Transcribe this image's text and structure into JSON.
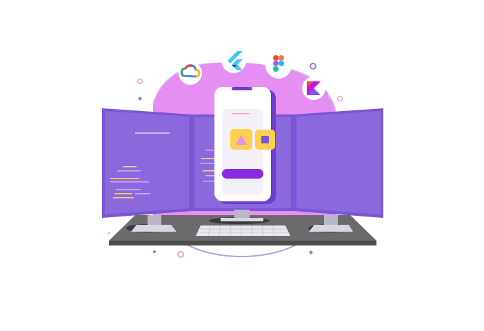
{
  "illustration": {
    "icons": [
      "google-cloud-icon",
      "flutter-icon",
      "figma-icon",
      "kotlin-icon"
    ],
    "colors": {
      "background": "#ffffff",
      "blob": "#e68ff3",
      "orbit": "#b89be8",
      "monitor_frame": "#7a55d6",
      "monitor_screen": "#8c68dd",
      "code_line": "#c9b6f5",
      "code_line_accent": "#ffd36b",
      "desk_top": "#6b6b6b",
      "desk_edge": "#4c4c4c",
      "phone_body": "#ffffff",
      "phone_screen": "#f3f1f8",
      "phone_button": "#8a2be2",
      "tile": "#ffcf4f",
      "tile_shape_triangle": "#e68ff3",
      "tile_shape_square": "#7a55d6",
      "keyboard": "#e9e9ef",
      "dot_pink": "#f0a0c8",
      "dot_purple": "#9b7ad8"
    }
  }
}
